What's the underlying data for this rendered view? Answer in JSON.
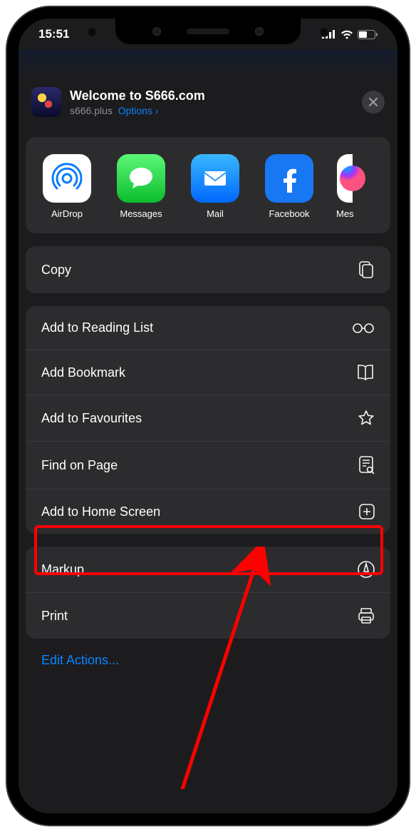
{
  "status": {
    "time": "15:51"
  },
  "header": {
    "title": "Welcome to S666.com",
    "domain": "s666.plus",
    "options": "Options"
  },
  "share_targets": [
    {
      "label": "AirDrop"
    },
    {
      "label": "Messages"
    },
    {
      "label": "Mail"
    },
    {
      "label": "Facebook"
    },
    {
      "label": "Mes"
    }
  ],
  "actions": {
    "copy": "Copy",
    "reading_list": "Add to Reading List",
    "bookmark": "Add Bookmark",
    "favourites": "Add to Favourites",
    "find": "Find on Page",
    "home_screen": "Add to Home Screen",
    "markup": "Markup",
    "print": "Print",
    "edit": "Edit Actions..."
  }
}
